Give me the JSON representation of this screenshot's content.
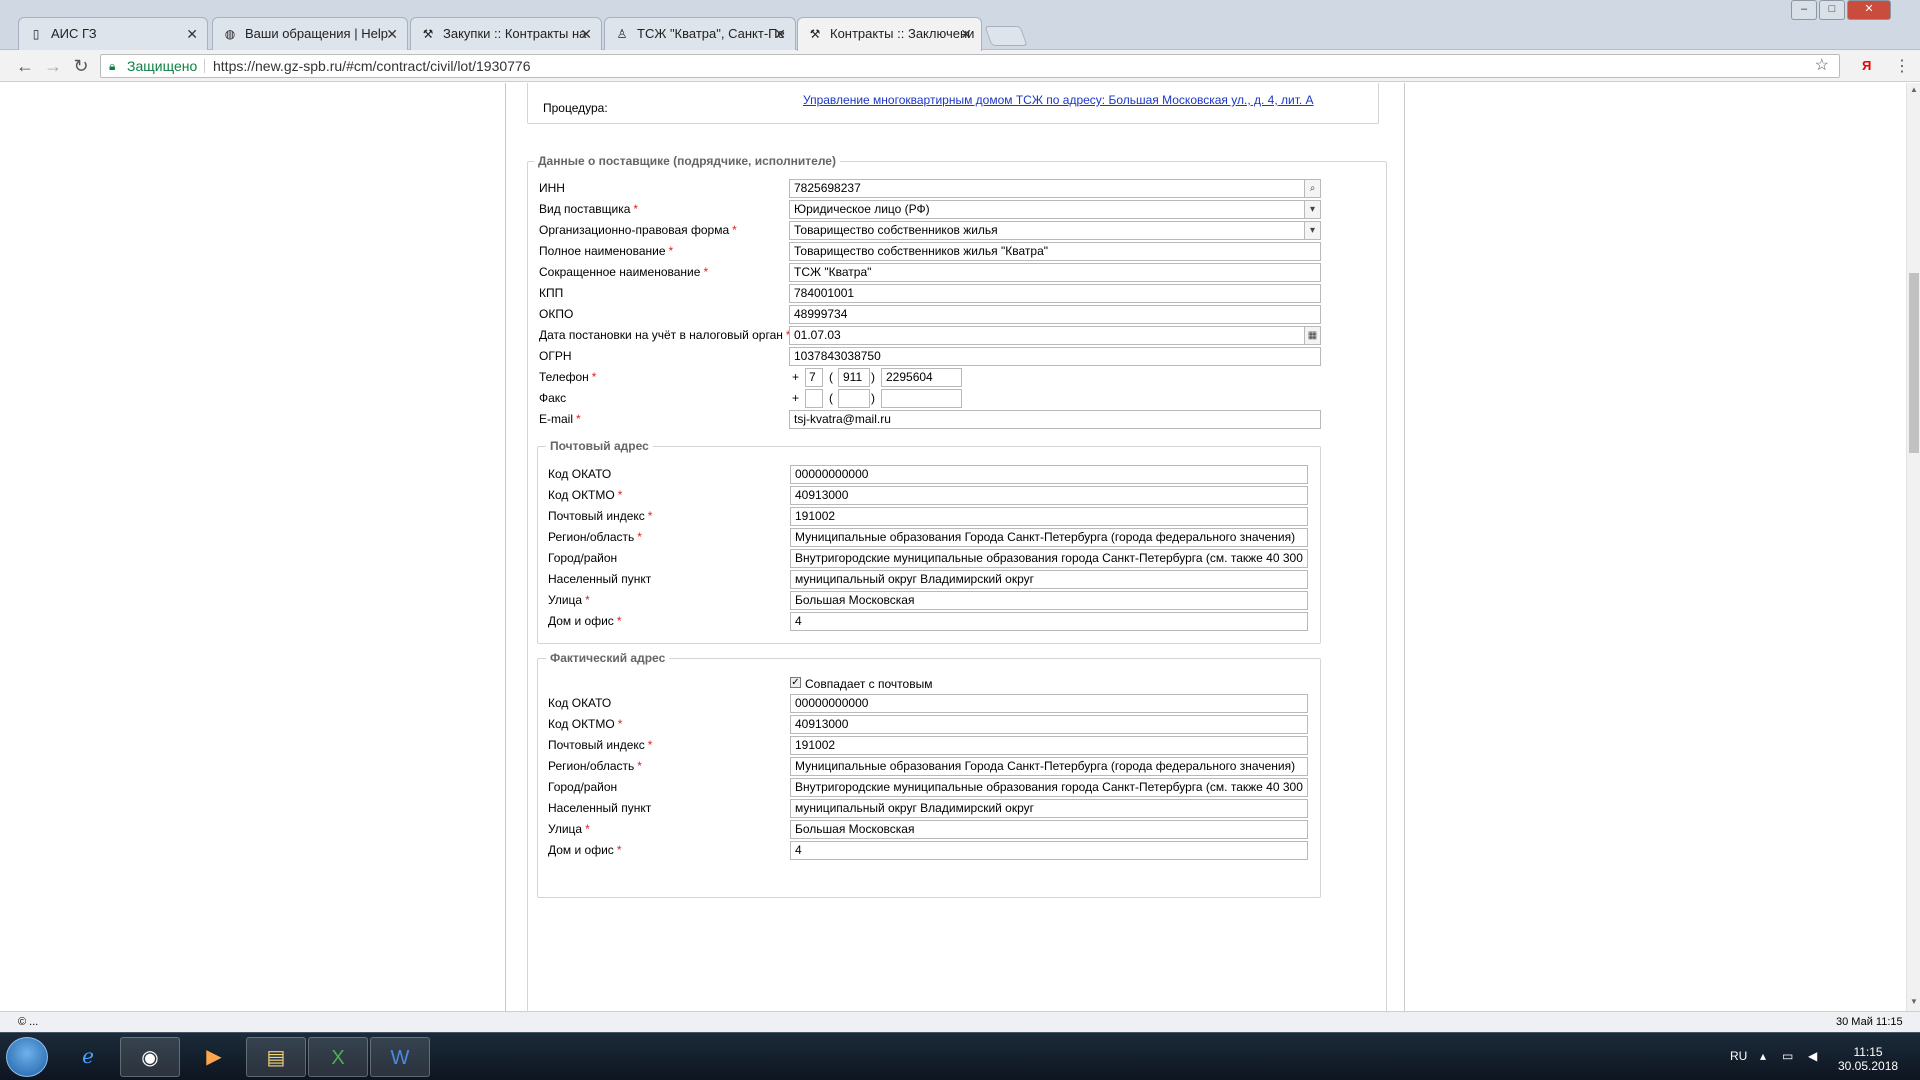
{
  "browser": {
    "tabs": [
      {
        "label": "АИС ГЗ",
        "icon": "page-icon"
      },
      {
        "label": "Ваши обращения | Help",
        "icon": "globe-icon"
      },
      {
        "label": "Закупки :: Контракты на",
        "icon": "gavel-icon"
      },
      {
        "label": "ТСЖ \"Кватра\", Санкт-Пе",
        "icon": "person-icon"
      },
      {
        "label": "Контракты :: Заключени",
        "icon": "gavel-icon"
      }
    ],
    "secure_label": "Защищено",
    "url": "https://new.gz-spb.ru/#cm/contract/civil/lot/1930776",
    "yandex_label": "Я"
  },
  "procedure": {
    "label": "Процедура:",
    "link_text": "Управление многоквартирным домом ТСЖ по адресу: Большая Московская ул., д. 4, лит. А"
  },
  "supplier": {
    "legend": "Данные о поставщике (подрядчике, исполнителе)",
    "inn_label": "ИНН",
    "inn": "7825698237",
    "type_label": "Вид поставщика",
    "type": "Юридическое лицо (РФ)",
    "legal_form_label": "Организационно-правовая форма",
    "legal_form": "Товарищество собственников жилья",
    "full_name_label": "Полное наименование",
    "full_name": "Товарищество собственников жилья \"Кватра\"",
    "short_name_label": "Сокращенное наименование",
    "short_name": "ТСЖ \"Кватра\"",
    "kpp_label": "КПП",
    "kpp": "784001001",
    "okpo_label": "ОКПО",
    "okpo": "48999734",
    "reg_date_label": "Дата постановки на учёт в налоговый орган",
    "reg_date": "01.07.03",
    "ogrn_label": "ОГРН",
    "ogrn": "1037843038750",
    "phone_label": "Телефон",
    "phone": {
      "plus": "+",
      "country": "7",
      "open": "(",
      "code": "911",
      "close": ")",
      "number": "2295604"
    },
    "fax_label": "Факс",
    "fax": {
      "plus": "+",
      "country": "",
      "open": "(",
      "code": "",
      "close": ")",
      "number": ""
    },
    "email_label": "E-mail",
    "email": "tsj-kvatra@mail.ru",
    "required_mark": "*"
  },
  "postal_address": {
    "legend": "Почтовый адрес",
    "okato_label": "Код ОКАТО",
    "okato": "00000000000",
    "oktmo_label": "Код ОКТМО",
    "oktmo": "40913000",
    "index_label": "Почтовый индекс",
    "index": "191002",
    "region_label": "Регион/область",
    "region": "Муниципальные образования Города Санкт-Петербурга (города федерального значения)",
    "city_label": "Город/район",
    "city": "Внутригородские муниципальные образования города Санкт-Петербурга (см. также 40 300",
    "locality_label": "Населенный пункт",
    "locality": "муниципальный округ Владимирский округ",
    "street_label": "Улица",
    "street": "Большая Московская",
    "house_label": "Дом и офис",
    "house": "4"
  },
  "actual_address": {
    "legend": "Фактический адрес",
    "same_as_postal_label": "Совпадает с почтовым",
    "same_as_postal": true,
    "okato_label": "Код ОКАТО",
    "okato": "00000000000",
    "oktmo_label": "Код ОКТМО",
    "oktmo": "40913000",
    "index_label": "Почтовый индекс",
    "index": "191002",
    "region_label": "Регион/область",
    "region": "Муниципальные образования Города Санкт-Петербурга (города федерального значения)",
    "city_label": "Город/район",
    "city": "Внутригородские муниципальные образования города Санкт-Петербурга (см. также 40 300",
    "locality_label": "Населенный пункт",
    "locality": "муниципальный округ Владимирский округ",
    "street_label": "Улица",
    "street": "Большая Московская",
    "house_label": "Дом и офис",
    "house": "4"
  },
  "statusbar": {
    "left": "© ...",
    "right": "30 Май 11:15"
  },
  "taskbar": {
    "lang": "RU",
    "time": "11:15",
    "date": "30.05.2018"
  },
  "colors": {
    "link": "#1a37c6",
    "required": "#e02020",
    "secure": "#0b8043"
  }
}
